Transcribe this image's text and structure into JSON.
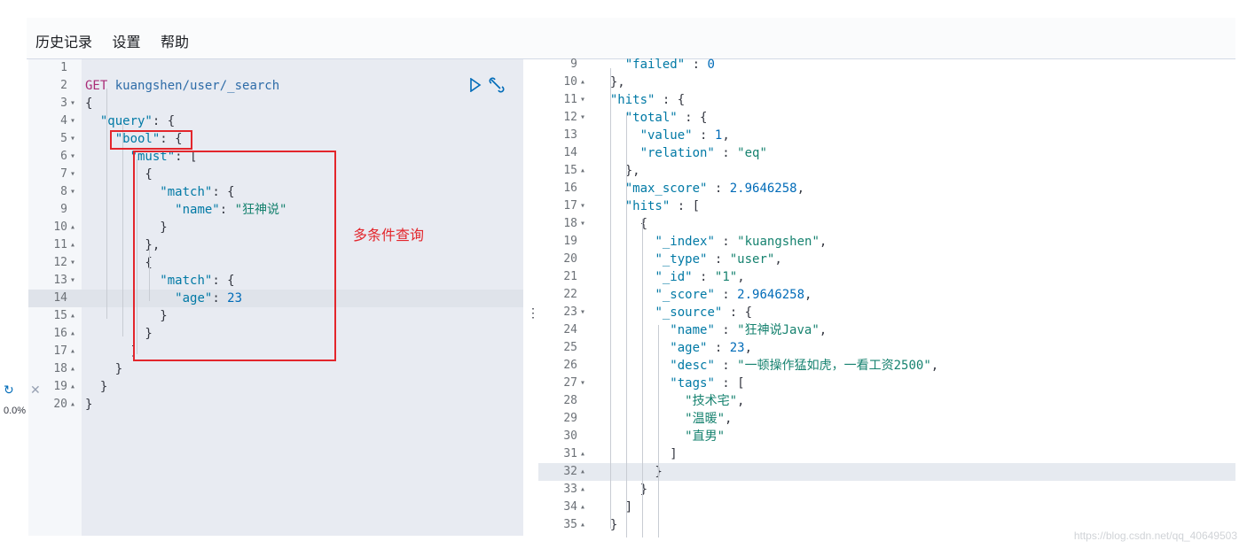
{
  "menu": {
    "history": "历史记录",
    "settings": "设置",
    "help": "帮助"
  },
  "request": {
    "method": "GET",
    "path": "kuangshen/user/_search",
    "lines": [
      {
        "n": "1",
        "fold": "",
        "html": ""
      },
      {
        "n": "2",
        "fold": "",
        "html": "<span class='method'>GET</span> <span class='url'>kuangshen/user/_search</span>"
      },
      {
        "n": "3",
        "fold": "▾",
        "html": "<span class='punc'>{</span>"
      },
      {
        "n": "4",
        "fold": "▾",
        "html": "  <span class='key'>\"query\"</span>: {"
      },
      {
        "n": "5",
        "fold": "▾",
        "html": "    <span class='key'>\"bool\"</span>: {"
      },
      {
        "n": "6",
        "fold": "▾",
        "html": "      <span class='key'>\"must\"</span>: ["
      },
      {
        "n": "7",
        "fold": "▾",
        "html": "        {"
      },
      {
        "n": "8",
        "fold": "▾",
        "html": "          <span class='key'>\"match\"</span>: {"
      },
      {
        "n": "9",
        "fold": "",
        "html": "            <span class='key'>\"name\"</span>: <span class='str'>\"狂神说\"</span>"
      },
      {
        "n": "10",
        "fold": "▴",
        "html": "          }"
      },
      {
        "n": "11",
        "fold": "▴",
        "html": "        },"
      },
      {
        "n": "12",
        "fold": "▾",
        "html": "        {"
      },
      {
        "n": "13",
        "fold": "▾",
        "html": "          <span class='key'>\"match\"</span>: {"
      },
      {
        "n": "14",
        "fold": "",
        "html": "            <span class='key'>\"age\"</span>: <span class='num'>23</span>"
      },
      {
        "n": "15",
        "fold": "▴",
        "html": "          }"
      },
      {
        "n": "16",
        "fold": "▴",
        "html": "        }"
      },
      {
        "n": "17",
        "fold": "▴",
        "html": "      ]"
      },
      {
        "n": "18",
        "fold": "▴",
        "html": "    }"
      },
      {
        "n": "19",
        "fold": "▴",
        "html": "  }"
      },
      {
        "n": "20",
        "fold": "▴",
        "html": "}"
      }
    ]
  },
  "response": {
    "lines": [
      {
        "n": "9",
        "fold": "",
        "html": "    <span class='key'>\"failed\"</span> : <span class='num'>0</span>"
      },
      {
        "n": "10",
        "fold": "▴",
        "html": "  },"
      },
      {
        "n": "11",
        "fold": "▾",
        "html": "  <span class='key'>\"hits\"</span> : {"
      },
      {
        "n": "12",
        "fold": "▾",
        "html": "    <span class='key'>\"total\"</span> : {"
      },
      {
        "n": "13",
        "fold": "",
        "html": "      <span class='key'>\"value\"</span> : <span class='num'>1</span>,"
      },
      {
        "n": "14",
        "fold": "",
        "html": "      <span class='key'>\"relation\"</span> : <span class='str'>\"eq\"</span>"
      },
      {
        "n": "15",
        "fold": "▴",
        "html": "    },"
      },
      {
        "n": "16",
        "fold": "",
        "html": "    <span class='key'>\"max_score\"</span> : <span class='num'>2.9646258</span>,"
      },
      {
        "n": "17",
        "fold": "▾",
        "html": "    <span class='key'>\"hits\"</span> : ["
      },
      {
        "n": "18",
        "fold": "▾",
        "html": "      {"
      },
      {
        "n": "19",
        "fold": "",
        "html": "        <span class='key'>\"_index\"</span> : <span class='str'>\"kuangshen\"</span>,"
      },
      {
        "n": "20",
        "fold": "",
        "html": "        <span class='key'>\"_type\"</span> : <span class='str'>\"user\"</span>,"
      },
      {
        "n": "21",
        "fold": "",
        "html": "        <span class='key'>\"_id\"</span> : <span class='str'>\"1\"</span>,"
      },
      {
        "n": "22",
        "fold": "",
        "html": "        <span class='key'>\"_score\"</span> : <span class='num'>2.9646258</span>,"
      },
      {
        "n": "23",
        "fold": "▾",
        "html": "        <span class='key'>\"_source\"</span> : {"
      },
      {
        "n": "24",
        "fold": "",
        "html": "          <span class='key'>\"name\"</span> : <span class='str'>\"狂神说Java\"</span>,"
      },
      {
        "n": "25",
        "fold": "",
        "html": "          <span class='key'>\"age\"</span> : <span class='num'>23</span>,"
      },
      {
        "n": "26",
        "fold": "",
        "html": "          <span class='key'>\"desc\"</span> : <span class='str'>\"一顿操作猛如虎，一看工资2500\"</span>,"
      },
      {
        "n": "27",
        "fold": "▾",
        "html": "          <span class='key'>\"tags\"</span> : ["
      },
      {
        "n": "28",
        "fold": "",
        "html": "            <span class='str'>\"技术宅\"</span>,"
      },
      {
        "n": "29",
        "fold": "",
        "html": "            <span class='str'>\"温暖\"</span>,"
      },
      {
        "n": "30",
        "fold": "",
        "html": "            <span class='str'>\"直男\"</span>"
      },
      {
        "n": "31",
        "fold": "▴",
        "html": "          ]"
      },
      {
        "n": "32",
        "fold": "▴",
        "html": "        }"
      },
      {
        "n": "33",
        "fold": "▴",
        "html": "      }"
      },
      {
        "n": "34",
        "fold": "▴",
        "html": "    ]"
      },
      {
        "n": "35",
        "fold": "▴",
        "html": "  }"
      }
    ]
  },
  "annotation": {
    "text": "多条件查询",
    "color": "#e3262c"
  },
  "side": {
    "percent": "0.0%"
  },
  "watermark": "https://blog.csdn.net/qq_40649503",
  "colors": {
    "key": "#0079a5",
    "string": "#16826f",
    "number": "#006bb8",
    "method": "#aa2c77"
  }
}
